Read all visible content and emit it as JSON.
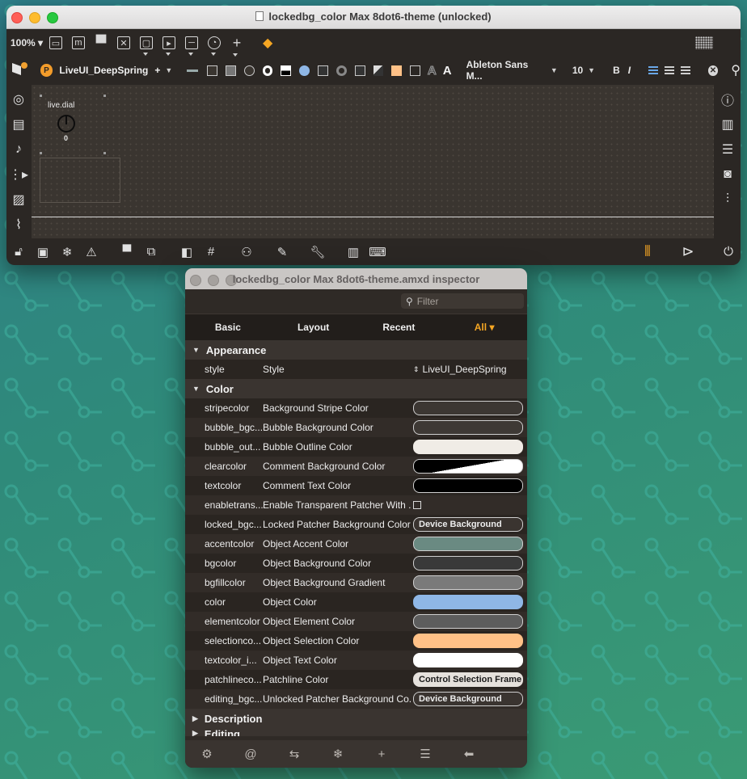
{
  "main_window": {
    "title": "lockedbg_color Max 8dot6-theme (unlocked)",
    "zoom": "100%",
    "style_name": "LiveUI_DeepSpring",
    "font_name": "Ableton Sans M...",
    "font_size": "10",
    "bold": "B",
    "italic": "I",
    "dial_label": "live.dial",
    "dial_value": "0"
  },
  "inspector": {
    "title": "lockedbg_color Max 8dot6-theme.amxd inspector",
    "filter_placeholder": "Filter",
    "tabs": [
      "Basic",
      "Layout",
      "Recent",
      "All"
    ],
    "active_tab": "All",
    "sections": {
      "appearance": "Appearance",
      "color": "Color",
      "description": "Description",
      "editing": "Editing"
    },
    "style_row": {
      "name": "style",
      "label": "Style",
      "value": "LiveUI_DeepSpring"
    },
    "color_rows": [
      {
        "name": "stripecolor",
        "label": "Background Stripe Color",
        "kind": "color",
        "color": "#3c3733",
        "border": "#cfcfcf"
      },
      {
        "name": "bubble_bgc...",
        "label": "Bubble Background Color",
        "kind": "color",
        "color": "#3e3935",
        "border": "#cfcfcf"
      },
      {
        "name": "bubble_out...",
        "label": "Bubble Outline Color",
        "kind": "color",
        "color": "#f0ece6",
        "border": "#f0ece6"
      },
      {
        "name": "clearcolor",
        "label": "Comment Background Color",
        "kind": "split",
        "color": "#000000",
        "color2": "#ffffff",
        "border": "#cfcfcf"
      },
      {
        "name": "textcolor",
        "label": "Comment Text Color",
        "kind": "color",
        "color": "#000000",
        "border": "#cfcfcf"
      },
      {
        "name": "enabletrans...",
        "label": "Enable Transparent Patcher With ...",
        "kind": "checkbox"
      },
      {
        "name": "locked_bgc...",
        "label": "Locked Patcher Background Color",
        "kind": "text",
        "value": "Device Background",
        "color": "#3a3430",
        "border": "#cfcfcf"
      },
      {
        "name": "accentcolor",
        "label": "Object Accent Color",
        "kind": "color",
        "color": "#6a8a82",
        "border": "#cfcfcf"
      },
      {
        "name": "bgcolor",
        "label": "Object Background Color",
        "kind": "color",
        "color": "#393939",
        "border": "#cfcfcf"
      },
      {
        "name": "bgfillcolor",
        "label": "Object Background Gradient",
        "kind": "color",
        "color": "#7a7a7a",
        "border": "#cfcfcf"
      },
      {
        "name": "color",
        "label": "Object Color",
        "kind": "color",
        "color": "#8fb7e6",
        "border": "#8fb7e6"
      },
      {
        "name": "elementcolor",
        "label": "Object Element Color",
        "kind": "color",
        "color": "#5d5d5d",
        "border": "#cfcfcf"
      },
      {
        "name": "selectionco...",
        "label": "Object Selection Color",
        "kind": "color",
        "color": "#ffc187",
        "border": "#ffc187"
      },
      {
        "name": "textcolor_i...",
        "label": "Object Text Color",
        "kind": "color",
        "color": "#ffffff",
        "border": "#ffffff"
      },
      {
        "name": "patchlineco...",
        "label": "Patchline Color",
        "kind": "text",
        "value": "Control Selection Frame",
        "color": "#e5e1dc",
        "border": "#e5e1dc",
        "textcolor": "#1a1a1a"
      },
      {
        "name": "editing_bgc...",
        "label": "Unlocked Patcher Background Co...",
        "kind": "text",
        "value": "Device Background",
        "color": "#3a3430",
        "border": "#cfcfcf"
      }
    ]
  }
}
